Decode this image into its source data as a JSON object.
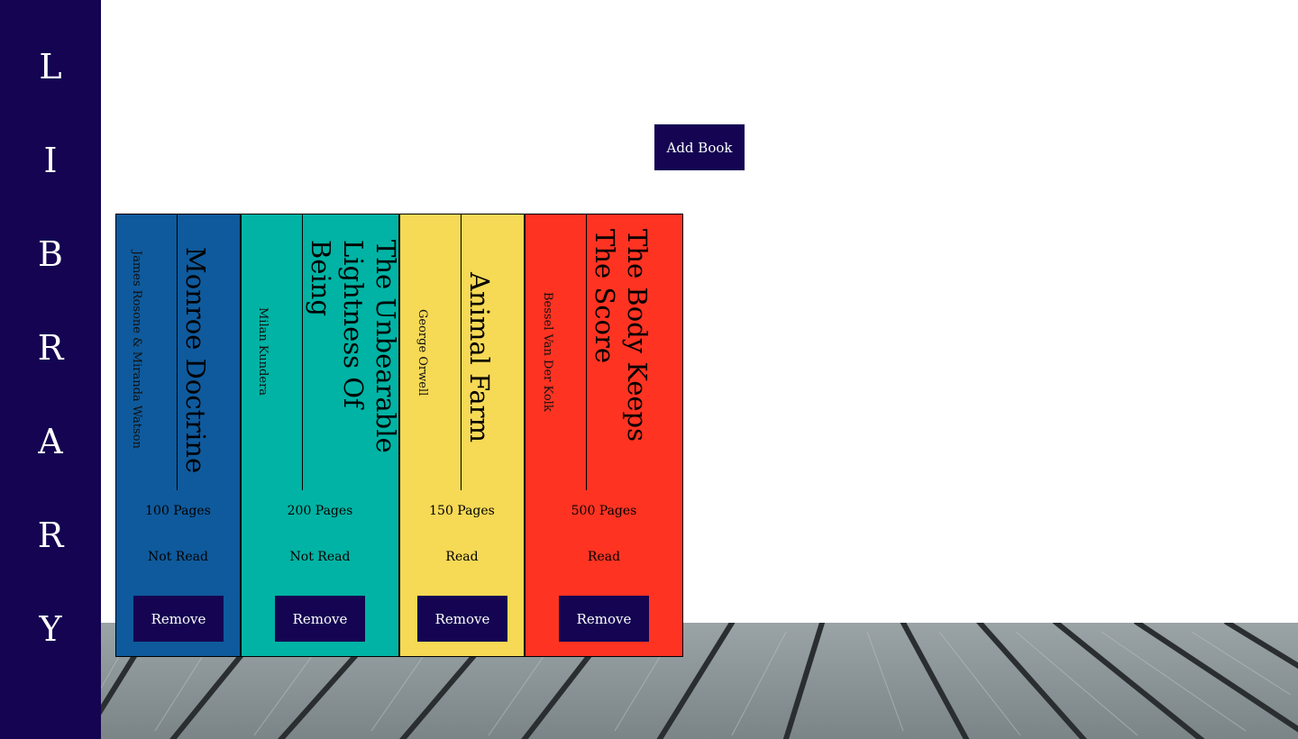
{
  "sidebar": {
    "letters": [
      "L",
      "I",
      "B",
      "R",
      "A",
      "R",
      "Y"
    ]
  },
  "toolbar": {
    "add_book_label": "Add Book"
  },
  "books": [
    {
      "title": "Monroe Doctrine",
      "author": "James Rosone & Miranda Watson",
      "pages": "100 Pages",
      "status": "Not Read",
      "remove_label": "Remove",
      "color": "#0f5a9c"
    },
    {
      "title": "The Unbearable Lightness Of Being",
      "author": "Milan Kundera",
      "pages": "200 Pages",
      "status": "Not Read",
      "remove_label": "Remove",
      "color": "#00b3a4"
    },
    {
      "title": "Animal Farm",
      "author": "George Orwell",
      "pages": "150 Pages",
      "status": "Read",
      "remove_label": "Remove",
      "color": "#f6d955"
    },
    {
      "title": "The Body Keeps The Score",
      "author": "Bessel Van Der Kolk",
      "pages": "500 Pages",
      "status": "Read",
      "remove_label": "Remove",
      "color": "#ff3322"
    }
  ]
}
